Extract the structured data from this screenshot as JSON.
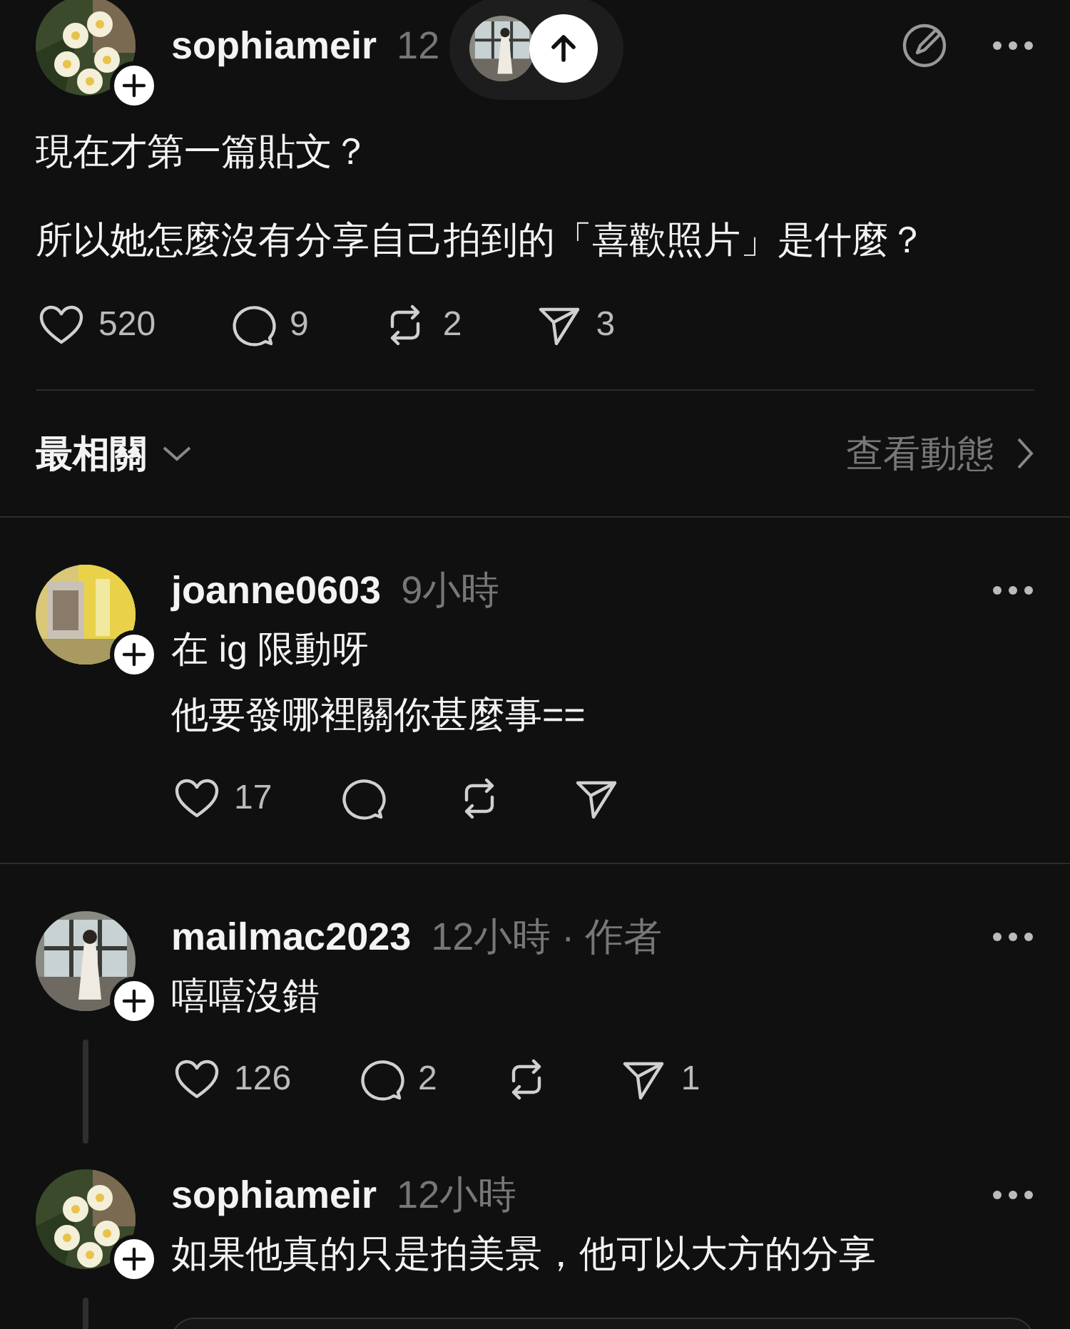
{
  "post": {
    "author": "sophiameir",
    "time": "12",
    "paragraphs": [
      "現在才第一篇貼文？",
      "所以她怎麼沒有分享自己拍到的「喜歡照片」是什麼？"
    ],
    "actions": [
      {
        "kind": "like",
        "count": "520"
      },
      {
        "kind": "comment",
        "count": "9"
      },
      {
        "kind": "repost",
        "count": "2"
      },
      {
        "kind": "share",
        "count": "3"
      }
    ]
  },
  "sort": {
    "label": "最相關",
    "activity_link": "查看動態"
  },
  "comments": [
    {
      "author": "joanne0603",
      "time": "9小時",
      "lines": [
        "在 ig 限動呀",
        "他要發哪裡關你甚麼事=="
      ],
      "thread_line": false,
      "divider_after": true,
      "actions": [
        {
          "kind": "like",
          "count": "17"
        },
        {
          "kind": "comment"
        },
        {
          "kind": "repost"
        },
        {
          "kind": "share"
        }
      ]
    },
    {
      "author": "mailmac2023",
      "time": "12小時 · 作者",
      "lines": [
        "嘻嘻沒錯"
      ],
      "thread_line": true,
      "divider_after": false,
      "actions": [
        {
          "kind": "like",
          "count": "126"
        },
        {
          "kind": "comment",
          "count": "2"
        },
        {
          "kind": "repost"
        },
        {
          "kind": "share",
          "count": "1"
        }
      ]
    },
    {
      "author": "sophiameir",
      "time": "12小時",
      "lines": [
        "如果他真的只是拍美景，他可以大方的分享"
      ],
      "thread_line": true,
      "divider_after": false,
      "media_card": true
    }
  ]
}
